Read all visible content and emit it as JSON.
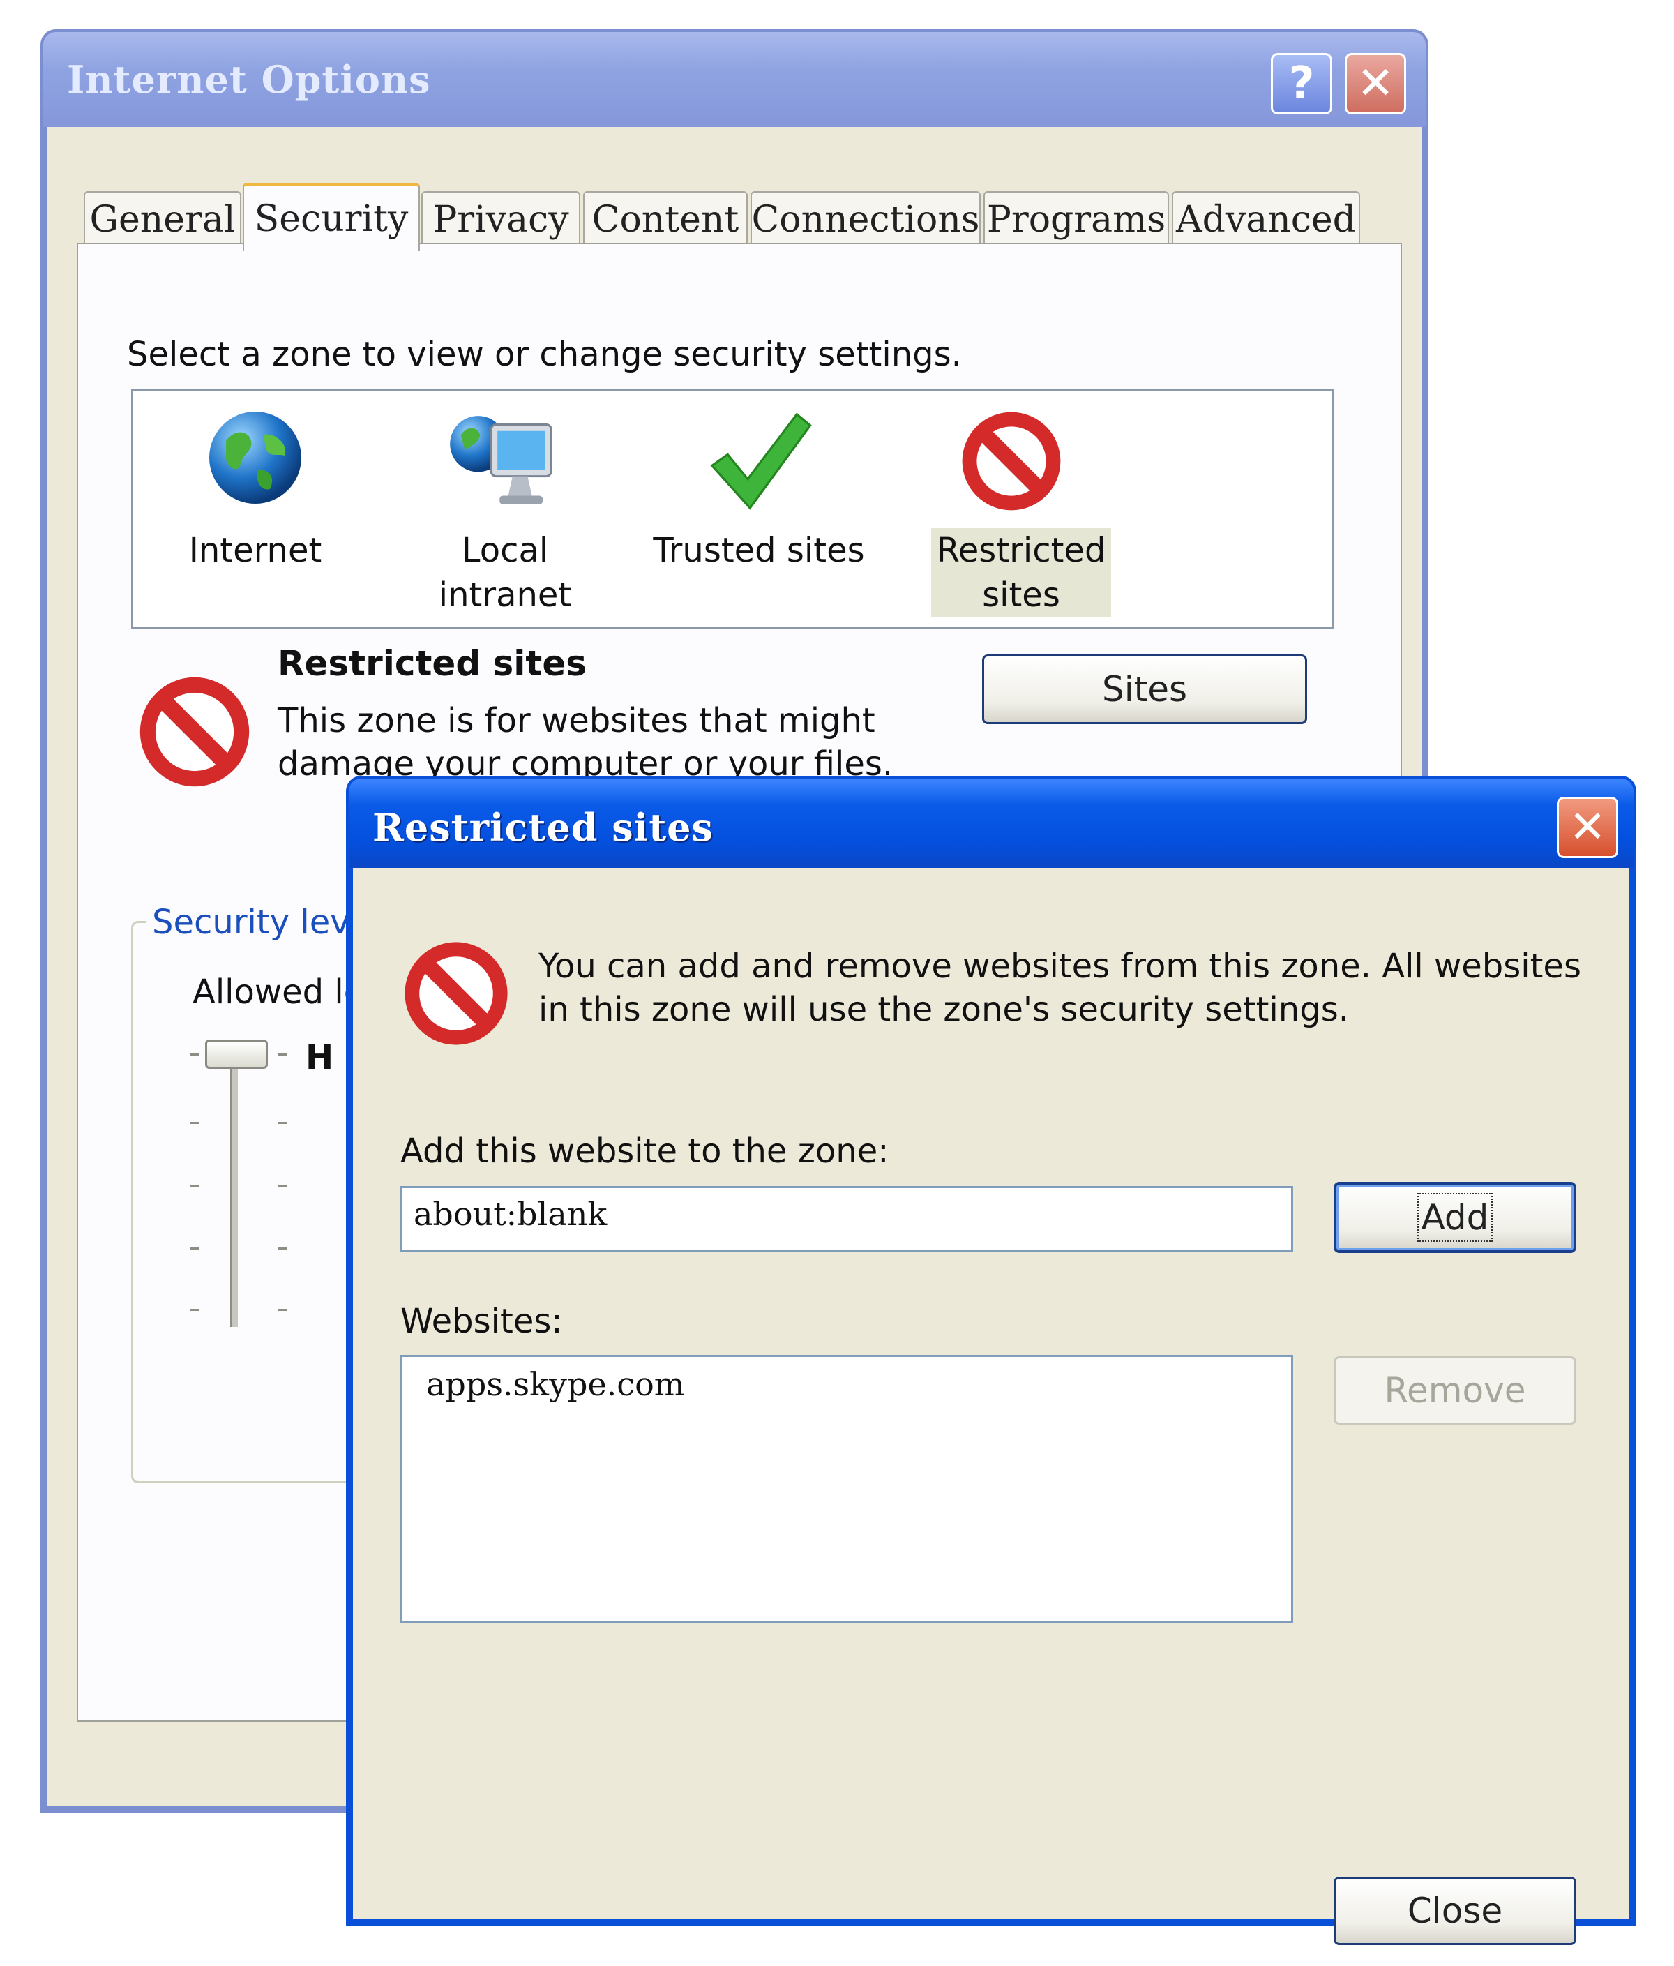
{
  "main_window": {
    "title": "Internet Options",
    "help_glyph": "?",
    "close_glyph": "✕",
    "tabs": [
      {
        "label": "General"
      },
      {
        "label": "Security",
        "active": true
      },
      {
        "label": "Privacy"
      },
      {
        "label": "Content"
      },
      {
        "label": "Connections"
      },
      {
        "label": "Programs"
      },
      {
        "label": "Advanced"
      }
    ],
    "zone_prompt": "Select a zone to view or change security settings.",
    "zones": [
      {
        "label": "Internet",
        "icon": "globe-icon"
      },
      {
        "label": "Local intranet",
        "icon": "intranet-computer-icon"
      },
      {
        "label": "Trusted sites",
        "icon": "checkmark-icon"
      },
      {
        "label": "Restricted sites",
        "icon": "no-entry-icon",
        "selected": true
      }
    ],
    "selected_zone": {
      "title": "Restricted sites",
      "description": "This zone is for websites that might damage your computer or your files.",
      "sites_button": "Sites"
    },
    "security_level": {
      "caption": "Security lev",
      "allowed": "Allowed le",
      "level_partial": "H"
    }
  },
  "dialog": {
    "title": "Restricted sites",
    "close_glyph": "✕",
    "message": "You can add and remove websites from this zone. All websites in this zone will use the zone's security settings.",
    "add_label": "Add this website to the zone:",
    "add_input_value": "about:blank",
    "add_button": "Add",
    "websites_label": "Websites:",
    "websites": [
      "apps.skype.com"
    ],
    "remove_button": "Remove",
    "close_button": "Close"
  },
  "colors": {
    "inactive_title": "#8fa3e2",
    "active_title": "#0450de",
    "dialog_face": "#ece9d8",
    "group_caption": "#1b4fbb"
  }
}
